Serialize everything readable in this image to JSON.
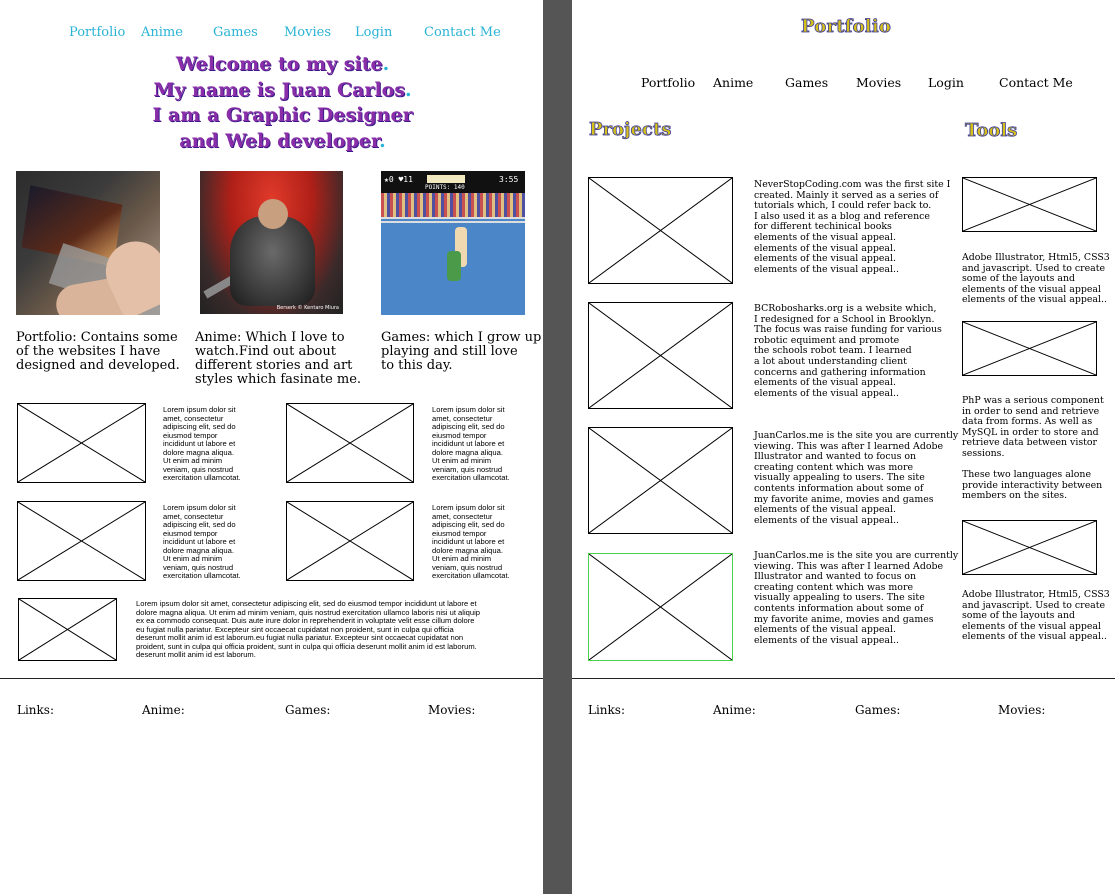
{
  "left": {
    "nav": [
      "Portfolio",
      "Anime",
      "Games",
      "Movies",
      "Login",
      "Contact Me"
    ],
    "welcome": [
      "Welcome to my site",
      "My name is Juan Carlos",
      "I am a Graphic Designer",
      "and Web developer"
    ],
    "welcome_dot": ".",
    "berserk_caption": "Berserk © Kentaro Miura",
    "punchout_hud": {
      "left": "★0 ♥11",
      "points": "POINTS: 140",
      "time": "3:55"
    },
    "captions": [
      "Portfolio: Contains some\nof the websites I have\ndesigned and developed.",
      "Anime: Which I love to\nwatch.Find out about\ndifferent stories and art\nstyles which fasinate me.",
      "Games: which I grow up\nplaying and still love\nto this day."
    ],
    "lorem_short": "Lorem ipsum dolor sit\namet, consectetur\nadipiscing elit, sed do\neiusmod tempor\nincididunt ut labore et\ndolore magna aliqua.\nUt enim ad minim\nveniam, quis nostrud\nexercitation ullamcotat.",
    "lorem_long": "Lorem ipsum dolor sit amet, consectetur adipiscing elit, sed do eiusmod tempor incididunt ut labore et\ndolore magna aliqua. Ut enim ad minim veniam, quis nostrud exercitation ullamco laboris nisi ut aliquip\nex ea commodo consequat. Duis aute irure dolor in reprehenderit in voluptate velit esse cillum dolore\neu fugiat nulla pariatur. Excepteur sint occaecat cupidatat non proident, sunt in culpa qui officia\ndeserunt mollit anim id est laborum.eu fugiat nulla pariatur. Excepteur sint occaecat cupidatat non\nproident, sunt in culpa qui officia proident, sunt in culpa qui officia deserunt mollit anim id est laborum.\n deserunt mollit anim id est laborum.",
    "footer": [
      "Links:",
      "Anime:",
      "Games:",
      "Movies:"
    ]
  },
  "right": {
    "title": "Portfolio",
    "nav": [
      "Portfolio",
      "Anime",
      "Games",
      "Movies",
      "Login",
      "Contact Me"
    ],
    "projects_heading": "Projects",
    "tools_heading": "Tools",
    "projects": [
      "NeverStopCoding.com was the first site I\ncreated. Mainly it served as a series of\ntutorials which, I could refer back to.\nI also used it as a blog and reference\nfor different techinical books\nelements of the visual appeal.\nelements of the visual appeal.\nelements of the visual appeal.\nelements of the visual appeal..",
      "BCRobosharks.org is a website which,\nI redesigned for a School in Brooklyn.\nThe focus was raise funding for various\nrobotic equiment and promote\nthe schools robot team. I learned\na lot about understanding client\nconcerns and gathering information\nelements of the visual appeal.\nelements of the visual appeal..",
      "JuanCarlos.me is the site you are currently\nviewing. This was after I learned Adobe\nIllustrator and wanted to focus on\ncreating content which was more\nvisually appealing to users. The site\ncontents information about some of\nmy favorite anime, movies and games\nelements of the visual appeal.\nelements of the visual appeal..",
      "JuanCarlos.me is the site you are currently\nviewing. This was after I learned Adobe\nIllustrator and wanted to focus on\ncreating content which was more\nvisually appealing to users. The site\ncontents information about some of\nmy favorite anime, movies and games\nelements of the visual appeal.\nelements of the visual appeal.."
    ],
    "tools": [
      "Adobe Illustrator, Html5, CSS3\nand javascript. Used to create\nsome of the layouts and\nelements of the visual appeal\nelements of the visual appeal..",
      "PhP was a serious component\nin order to send and retrieve\ndata from forms. As well as\nMySQL in order to store and\nretrieve data between vistor\nsessions.\n\nThese two languages alone\nprovide interactivity between\nmembers on the sites.",
      "Adobe Illustrator, Html5, CSS3\nand javascript. Used to create\nsome of the layouts and\nelements of the visual appeal\nelements of the visual appeal.."
    ],
    "footer": [
      "Links:",
      "Anime:",
      "Games:",
      "Movies:"
    ]
  },
  "colors": {
    "nav_cyan": "#2ab3d6",
    "welcome_purple": "#8a2da8",
    "heading_gold": "#d6c01a",
    "heading_outline": "#3a3a9a",
    "gutter_gray": "#555555",
    "selected_green": "#4ccf4c"
  }
}
